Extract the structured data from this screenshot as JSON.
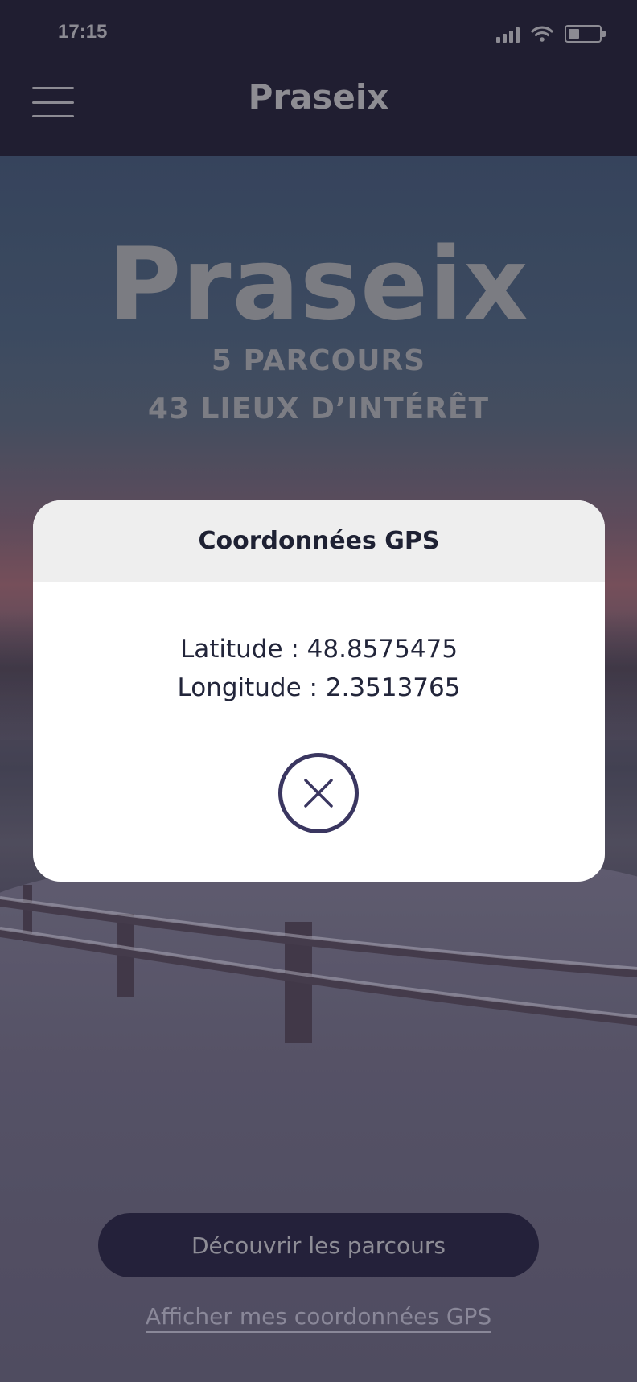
{
  "status_bar": {
    "time": "17:15",
    "icons": [
      "cellular-signal-icon",
      "wifi-icon",
      "battery-icon"
    ],
    "battery_level": 0.35
  },
  "header": {
    "title": "Praseix",
    "menu_icon": "hamburger-menu-icon"
  },
  "hero": {
    "title": "Praseix",
    "subtitle_routes": "5 PARCOURS",
    "subtitle_places": "43 LIEUX D’INTÉRÊT"
  },
  "actions": {
    "primary_button": "Découvrir les parcours",
    "gps_link": "Afficher mes coordonnées GPS"
  },
  "modal": {
    "title": "Coordonnées GPS",
    "latitude": "Latitude : 48.8575475",
    "longitude": "Longitude : 2.3513765",
    "close_icon": "close-icon"
  },
  "colors": {
    "header_bg": "#201e31",
    "button_bg": "#24213a",
    "modal_accent": "#3a3660",
    "modal_header_bg": "#eeeeee"
  }
}
